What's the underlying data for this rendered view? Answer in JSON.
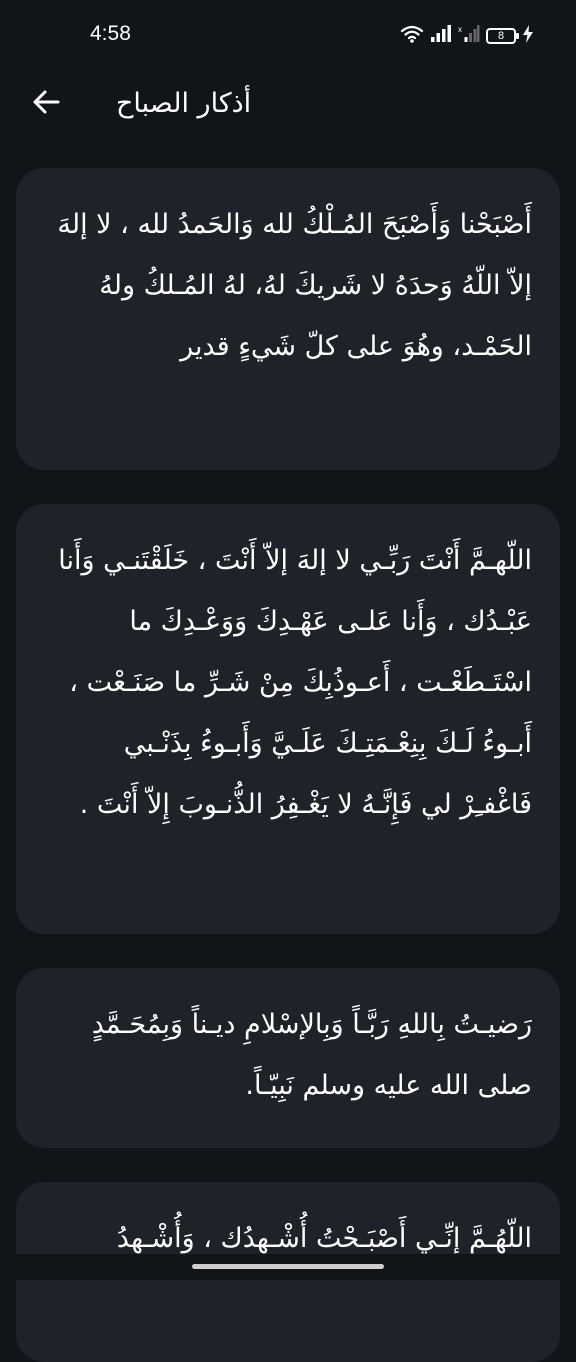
{
  "status_bar": {
    "time": "4:58",
    "battery_level": "8",
    "icons": [
      "wifi-icon",
      "signal-icon",
      "signal-x-icon",
      "battery-icon",
      "charging-icon"
    ]
  },
  "app_bar": {
    "title": "أذكار الصباح",
    "back_icon": "arrow-left-icon"
  },
  "cards": [
    {
      "text": "أَصْبَحْنا وَأَصْبَحَ المُـلْكُ لله وَالحَمدُ لله ، لا إلهَ إلاّ اللّهُ وَحدَهُ لا شَريكَ لهُ، لهُ المُـلكُ ولهُ الحَمْـد، وهُوَ على كلّ شَيءٍ قدير"
    },
    {
      "text": "اللّهـمَّ أَنْتَ رَبِّـي لا إلهَ إلاّ أَنْتَ ، خَلَقْتَنـي وَأَنا عَبْـدُك ، وَأَنا عَلـى عَهْـدِكَ وَوَعْـدِكَ ما اسْتَـطَعْـت ، أَعـوذُبِكَ مِنْ شَـرِّ ما صَنَـعْت ، أَبـوءُ لَـكَ بِنِعْـمَتِـكَ عَلَـيَّ وَأَبـوءُ بِذَنْـبي فَاغْفـِرْ لي فَإِنَّـهُ لا يَغْـفِرُ الذُّنـوبَ إِلاّ أَنْتَ ."
    },
    {
      "text": "رَضيـتُ بِاللهِ رَبَّـاً وَبِالإسْلامِ ديـناً وَبِمُحَـمَّدٍ صلى الله عليه وسلم نَبِيّـاً."
    },
    {
      "text": "اللّهُـمَّ إِنِّـي أَصْبَـحْتُ أُشْـهِدُك ، وَأُشْـهِدُ"
    }
  ]
}
